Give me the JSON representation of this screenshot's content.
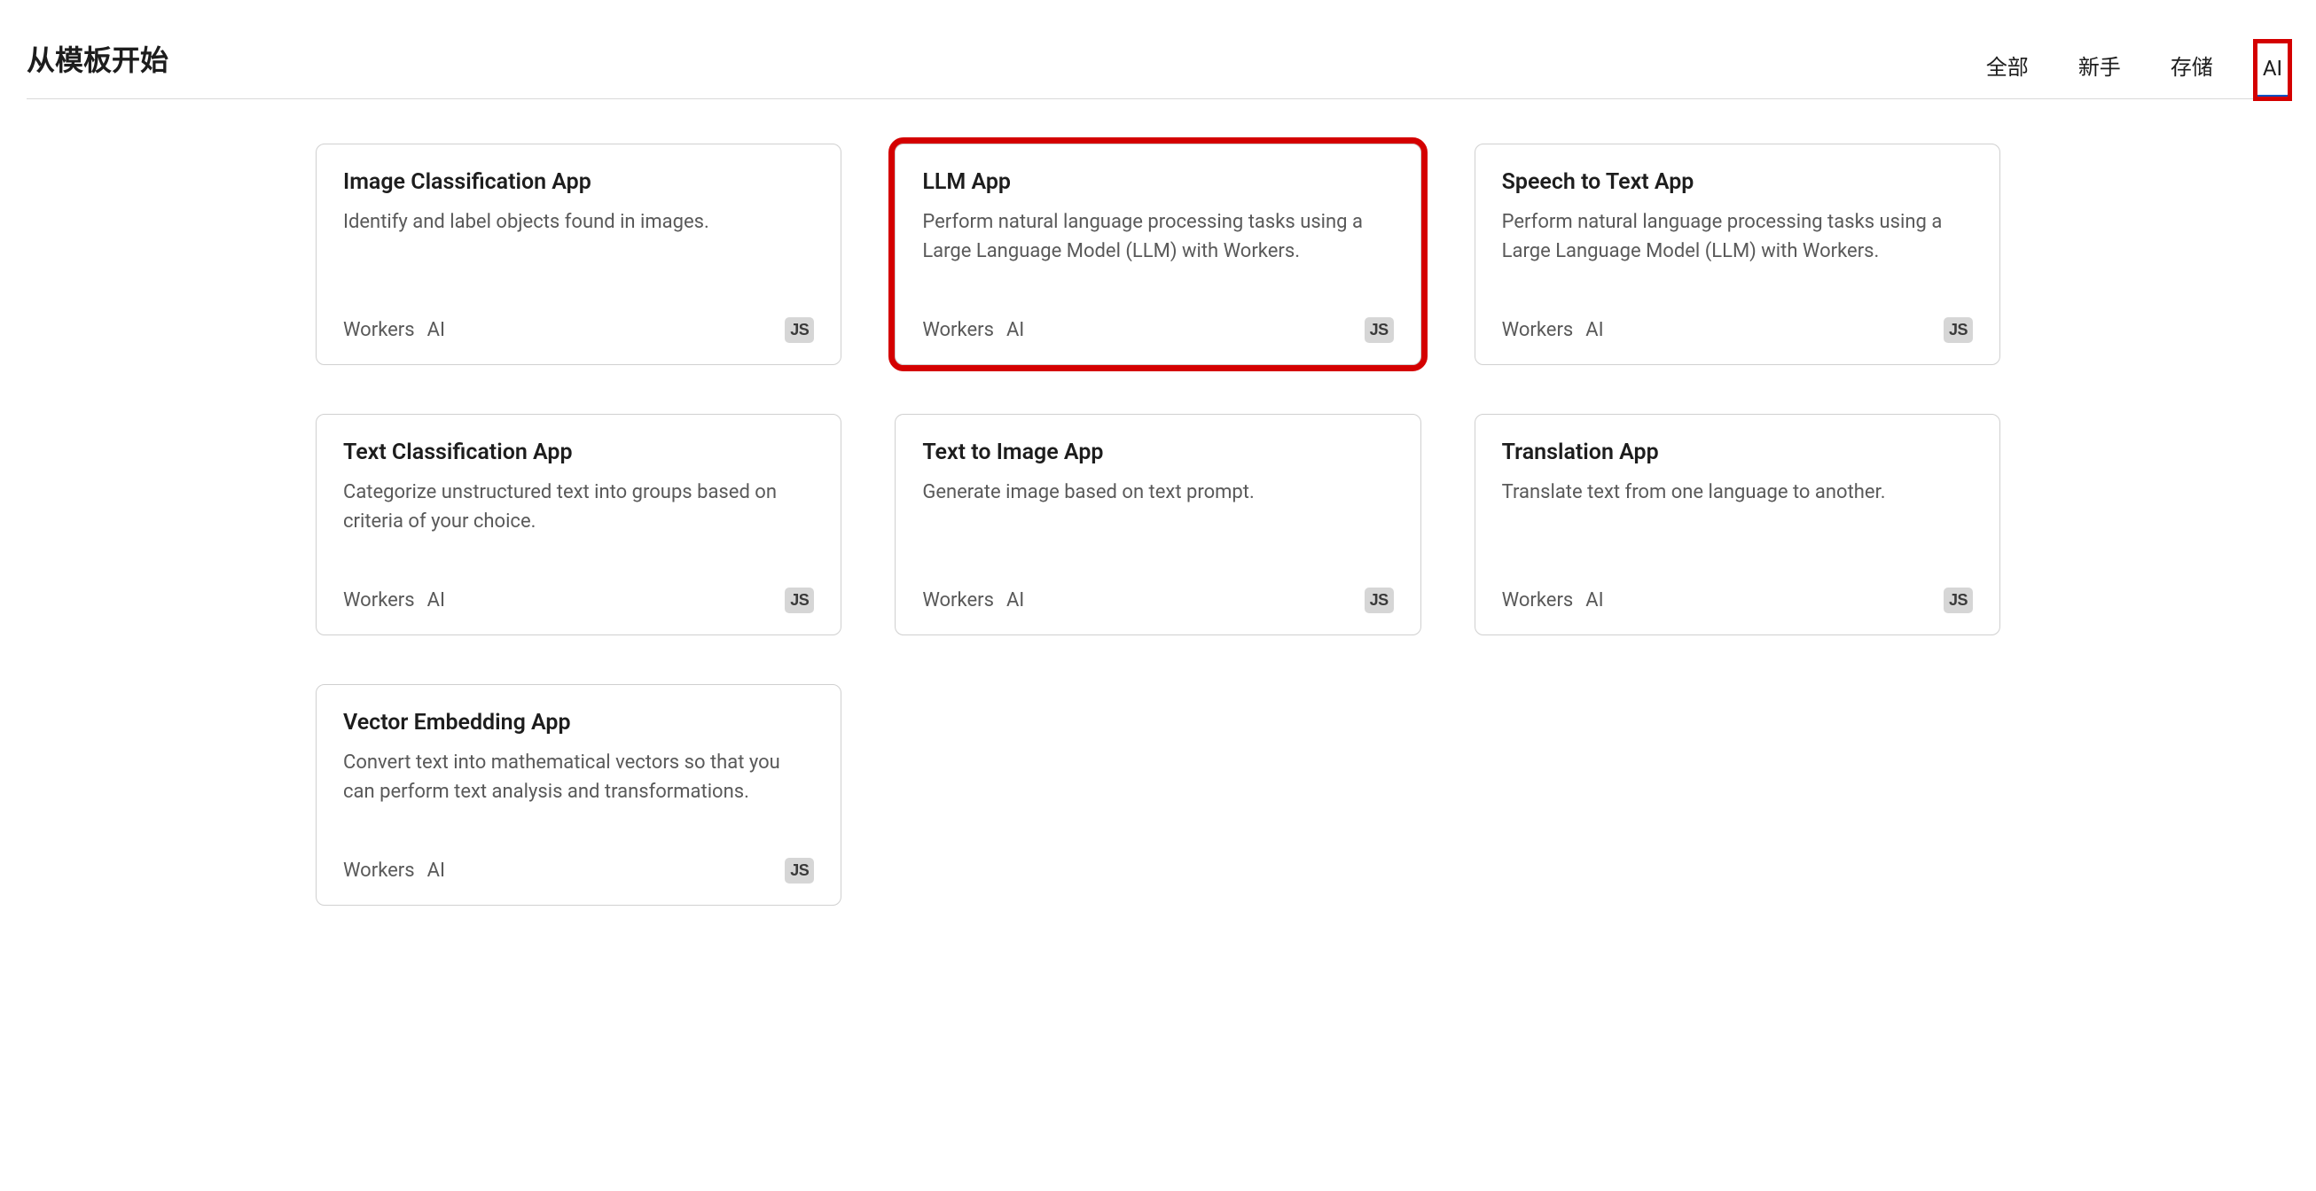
{
  "header": {
    "title": "从模板开始",
    "tabs": [
      {
        "label": "全部",
        "active": false,
        "highlighted": false
      },
      {
        "label": "新手",
        "active": false,
        "highlighted": false
      },
      {
        "label": "存储",
        "active": false,
        "highlighted": false
      },
      {
        "label": "AI",
        "active": true,
        "highlighted": true
      }
    ]
  },
  "cards": [
    {
      "title": "Image Classification App",
      "description": "Identify and label objects found in images.",
      "tags": [
        "Workers",
        "AI"
      ],
      "badge": "JS",
      "highlighted": false
    },
    {
      "title": "LLM App",
      "description": "Perform natural language processing tasks using a Large Language Model (LLM) with Workers.",
      "tags": [
        "Workers",
        "AI"
      ],
      "badge": "JS",
      "highlighted": true
    },
    {
      "title": "Speech to Text App",
      "description": "Perform natural language processing tasks using a Large Language Model (LLM) with Workers.",
      "tags": [
        "Workers",
        "AI"
      ],
      "badge": "JS",
      "highlighted": false
    },
    {
      "title": "Text Classification App",
      "description": "Categorize unstructured text into groups based on criteria of your choice.",
      "tags": [
        "Workers",
        "AI"
      ],
      "badge": "JS",
      "highlighted": false
    },
    {
      "title": "Text to Image App",
      "description": "Generate image based on text prompt.",
      "tags": [
        "Workers",
        "AI"
      ],
      "badge": "JS",
      "highlighted": false
    },
    {
      "title": "Translation App",
      "description": "Translate text from one language to another.",
      "tags": [
        "Workers",
        "AI"
      ],
      "badge": "JS",
      "highlighted": false
    },
    {
      "title": "Vector Embedding App",
      "description": "Convert text into mathematical vectors so that you can perform text analysis and transformations.",
      "tags": [
        "Workers",
        "AI"
      ],
      "badge": "JS",
      "highlighted": false
    }
  ]
}
